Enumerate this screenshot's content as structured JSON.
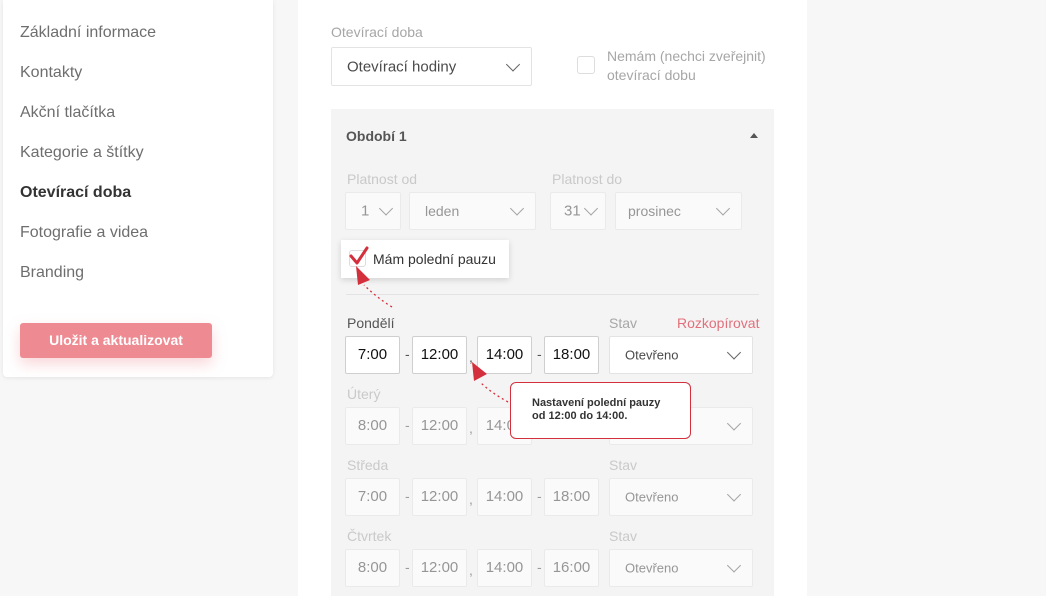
{
  "sidebar": {
    "items": [
      {
        "label": "Základní informace"
      },
      {
        "label": "Kontakty"
      },
      {
        "label": "Akční tlačítka"
      },
      {
        "label": "Kategorie a štítky"
      },
      {
        "label": "Otevírací doba"
      },
      {
        "label": "Fotografie a videa"
      },
      {
        "label": "Branding"
      }
    ],
    "active_index": 4,
    "save_label": "Uložit a aktualizovat"
  },
  "hours": {
    "label": "Otevírací doba",
    "type_value": "Otevírací hodiny",
    "no_publish_label_1": "Nemám (nechci zveřejnit)",
    "no_publish_label_2": "otevírací dobu"
  },
  "period": {
    "title": "Období 1",
    "valid_from_label": "Platnost od",
    "valid_to_label": "Platnost do",
    "from_day": "1",
    "from_month": "leden",
    "to_day": "31",
    "to_month": "prosinec",
    "lunch_break_label": "Mám polední pauzu",
    "lunch_break_checked": true,
    "status_label": "Stav",
    "copy_label": "Rozkopírovat",
    "days": [
      {
        "name": "Pondělí",
        "open": "7:00",
        "break_from": "12:00",
        "break_to": "14:00",
        "close": "18:00",
        "status": "Otevřeno"
      },
      {
        "name": "Úterý",
        "open": "8:00",
        "break_from": "12:00",
        "break_to": "14:00",
        "close": "",
        "status": ""
      },
      {
        "name": "Středa",
        "open": "7:00",
        "break_from": "12:00",
        "break_to": "14:00",
        "close": "18:00",
        "status": "Otevřeno"
      },
      {
        "name": "Čtvrtek",
        "open": "8:00",
        "break_from": "12:00",
        "break_to": "14:00",
        "close": "16:00",
        "status": "Otevřeno"
      }
    ]
  },
  "callout": {
    "line1": "Nastavení polední pauzy",
    "line2": "od 12:00 do 14:00."
  },
  "colors": {
    "accent": "#ee8a92",
    "callout_border": "#d32f3c",
    "link": "#e2707c"
  }
}
